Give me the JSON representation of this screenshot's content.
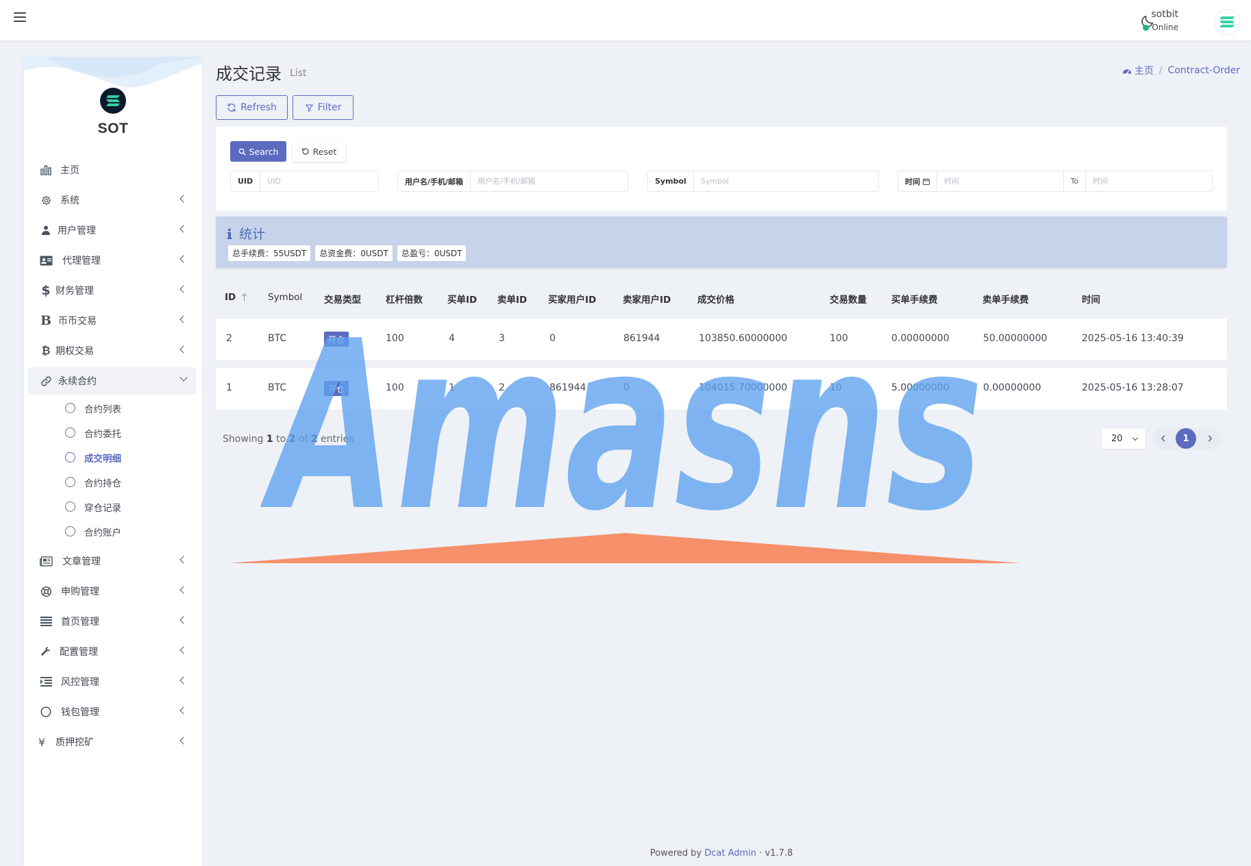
{
  "colors": {
    "accent": "#5c6bc0",
    "online": "#21b978",
    "stats_bg": "#c6d3ea",
    "watermark_text": "#5ea2ee",
    "watermark_base": "#f48a62"
  },
  "navbar": {
    "menu_icon": "hamburger-icon",
    "theme_icon": "moon-icon",
    "user_name": "sotbit",
    "user_status": "Online"
  },
  "sidebar": {
    "brand": "SOT",
    "items": [
      {
        "label": "主页",
        "icon": "bar-chart-icon"
      },
      {
        "label": "系统",
        "icon": "gear-icon"
      },
      {
        "label": "用户管理",
        "icon": "users-icon"
      },
      {
        "label": "代理管理",
        "icon": "id-card-icon"
      },
      {
        "label": "财务管理",
        "icon": "dollar-icon"
      },
      {
        "label": "币币交易",
        "icon": "b-letter-icon"
      },
      {
        "label": "期权交易",
        "icon": "bitcoin-icon"
      },
      {
        "label": "永续合约",
        "icon": "link-icon"
      },
      {
        "label": "文章管理",
        "icon": "newspaper-icon"
      },
      {
        "label": "申购管理",
        "icon": "life-ring-icon"
      },
      {
        "label": "首页管理",
        "icon": "list-icon"
      },
      {
        "label": "配置管理",
        "icon": "wrench-icon"
      },
      {
        "label": "风控管理",
        "icon": "indent-icon"
      },
      {
        "label": "钱包管理",
        "icon": "circle-icon"
      },
      {
        "label": "质押挖矿",
        "icon": "yen-icon"
      }
    ],
    "subitems": [
      {
        "label": "合约列表"
      },
      {
        "label": "合约委托"
      },
      {
        "label": "成交明细"
      },
      {
        "label": "合约持仓"
      },
      {
        "label": "穿仓记录"
      },
      {
        "label": "合约账户"
      }
    ]
  },
  "header": {
    "title": "成交记录",
    "subtitle": "List",
    "breadcrumb_home": "主页",
    "breadcrumb_current": "Contract-Order",
    "refresh_label": "Refresh",
    "filter_label": "Filter"
  },
  "filter": {
    "search_label": "Search",
    "reset_label": "Reset",
    "uid_label": "UID",
    "uid_placeholder": "UID",
    "user_label": "用户名/手机/邮箱",
    "user_placeholder": "用户名/手机/邮箱",
    "symbol_label": "Symbol",
    "symbol_placeholder": "Symbol",
    "time_label": "时间",
    "time_start_placeholder": "时间",
    "time_to": "To",
    "time_end_placeholder": "时间"
  },
  "stats": {
    "title": "统计",
    "fee": "总手续费：55USDT",
    "fund": "总资金费：0USDT",
    "pnl": "总盈亏：0USDT"
  },
  "table": {
    "columns": [
      "ID",
      "Symbol",
      "交易类型",
      "杠杆倍数",
      "买单ID",
      "卖单ID",
      "买家用户ID",
      "卖家用户ID",
      "成交价格",
      "交易数量",
      "买单手续费",
      "卖单手续费",
      "时间"
    ],
    "rows": [
      {
        "id": "2",
        "symbol": "BTC",
        "type": "开仓",
        "leverage": "100",
        "buy_id": "4",
        "sell_id": "3",
        "buyer": "0",
        "seller": "861944",
        "price": "103850.60000000",
        "qty": "100",
        "buy_fee": "0.00000000",
        "sell_fee": "50.00000000",
        "time": "2025-05-16 13:40:39"
      },
      {
        "id": "1",
        "symbol": "BTC",
        "type": "开仓",
        "leverage": "100",
        "buy_id": "1",
        "sell_id": "2",
        "buyer": "861944",
        "seller": "0",
        "price": "104015.70000000",
        "qty": "10",
        "buy_fee": "5.00000000",
        "sell_fee": "0.00000000",
        "time": "2025-05-16 13:28:07"
      }
    ]
  },
  "pagination": {
    "showing_prefix": "Showing",
    "from": "1",
    "to_word": "to",
    "to": "2",
    "of_word": "of",
    "total": "2",
    "suffix": "entries",
    "per_page": "20",
    "current_page": "1"
  },
  "footer": {
    "powered_by": "Powered by",
    "link": "Dcat Admin",
    "version": "· v1.7.8"
  },
  "watermark": {
    "text": "Amasns"
  }
}
